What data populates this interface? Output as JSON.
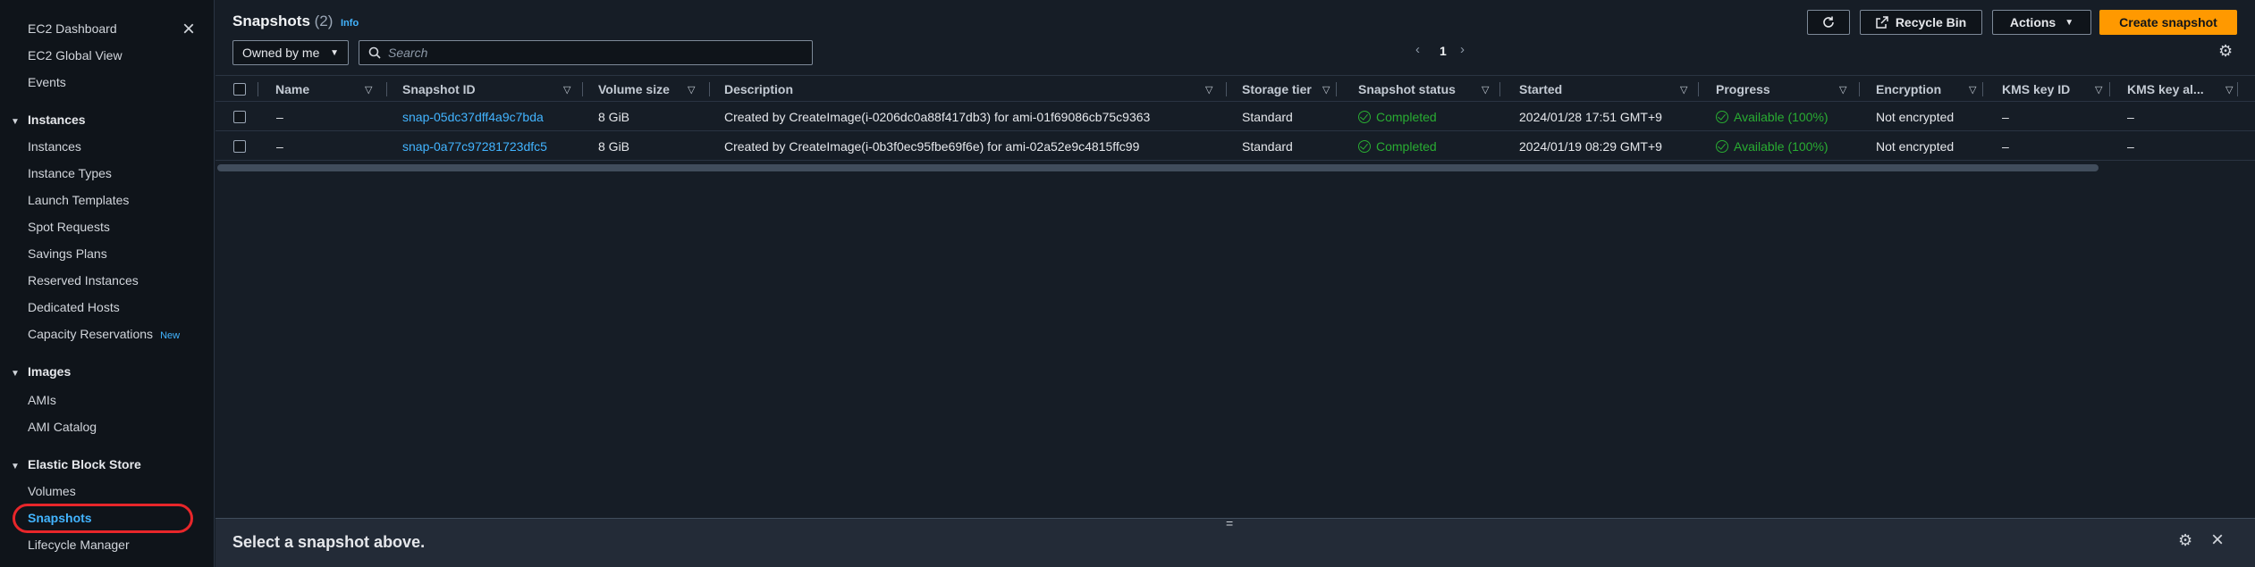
{
  "sidebar": {
    "close_icon": "×",
    "top_items": [
      "EC2 Dashboard",
      "EC2 Global View",
      "Events"
    ],
    "sections": [
      {
        "title": "Instances",
        "items": [
          "Instances",
          "Instance Types",
          "Launch Templates",
          "Spot Requests",
          "Savings Plans",
          "Reserved Instances",
          "Dedicated Hosts",
          "Capacity Reservations"
        ]
      },
      {
        "title": "Images",
        "items": [
          "AMIs",
          "AMI Catalog"
        ]
      },
      {
        "title": "Elastic Block Store",
        "items": [
          "Volumes",
          "Snapshots",
          "Lifecycle Manager"
        ]
      }
    ],
    "new_badge": "New",
    "active_item": "Snapshots",
    "highlight_color": "#e8262a"
  },
  "header": {
    "title": "Snapshots",
    "count": "(2)",
    "info": "Info",
    "refresh_icon": "refresh-icon",
    "recycle_bin": "Recycle Bin",
    "actions": "Actions",
    "create_snapshot": "Create snapshot",
    "filter_value": "Owned by me",
    "search_placeholder": "Search",
    "page_number": "1"
  },
  "table": {
    "columns": [
      "Name",
      "Snapshot ID",
      "Volume size",
      "Description",
      "Storage tier",
      "Snapshot status",
      "Started",
      "Progress",
      "Encryption",
      "KMS key ID",
      "KMS key al..."
    ],
    "rows": [
      {
        "name": "–",
        "snapshot_id": "snap-05dc37dff4a9c7bda",
        "volume_size": "8 GiB",
        "description": "Created by CreateImage(i-0206dc0a88f417db3) for ami-01f69086cb75c9363",
        "storage_tier": "Standard",
        "status": "Completed",
        "started": "2024/01/28 17:51 GMT+9",
        "progress": "Available (100%)",
        "encryption": "Not encrypted",
        "kms_key_id": "–",
        "kms_key_alias": "–"
      },
      {
        "name": "–",
        "snapshot_id": "snap-0a77c97281723dfc5",
        "volume_size": "8 GiB",
        "description": "Created by CreateImage(i-0b3f0ec95fbe69f6e) for ami-02a52e9c4815ffc99",
        "storage_tier": "Standard",
        "status": "Completed",
        "started": "2024/01/19 08:29 GMT+9",
        "progress": "Available (100%)",
        "encryption": "Not encrypted",
        "kms_key_id": "–",
        "kms_key_alias": "–"
      }
    ]
  },
  "bottom_panel": {
    "message": "Select a snapshot above.",
    "grip": "="
  },
  "colors": {
    "accent_link": "#42b4ff",
    "primary_button": "#ff9900",
    "success": "#29ad32",
    "background": "#161d26"
  }
}
